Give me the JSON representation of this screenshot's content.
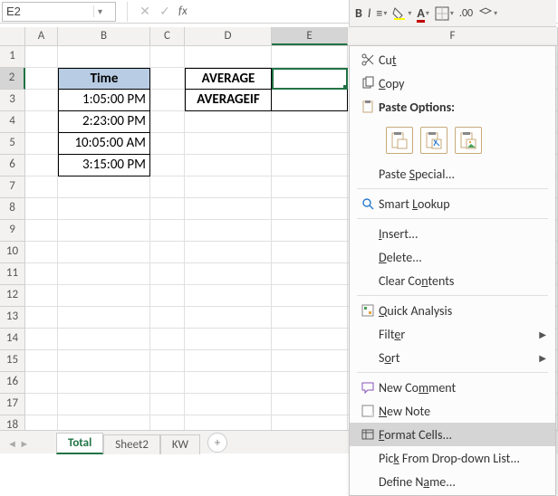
{
  "namebox": {
    "value": "E2"
  },
  "formula_bar": {
    "fx_label": "fx",
    "value": ""
  },
  "mini_ribbon": {
    "bold": "B",
    "italic": "I"
  },
  "columns": [
    "A",
    "B",
    "C",
    "D",
    "E",
    "F"
  ],
  "rows": [
    "1",
    "2",
    "3",
    "4",
    "5",
    "6",
    "7",
    "8",
    "9",
    "10",
    "11",
    "12",
    "13",
    "14",
    "15",
    "16",
    "17",
    "18"
  ],
  "cells": {
    "B2": "Time",
    "B3": "1:05:00 PM",
    "B4": "2:23:00 PM",
    "B5": "10:05:00 AM",
    "B6": "3:15:00 PM",
    "D2": "AVERAGE",
    "D3": "AVERAGEIF"
  },
  "sheet_tabs": {
    "tabs": [
      "Total",
      "Sheet2",
      "KW"
    ],
    "active": "Total",
    "new_label": "+"
  },
  "context_menu": {
    "cut": "Cut",
    "copy": "Copy",
    "paste_options": "Paste Options:",
    "paste_special": "Paste Special...",
    "smart_lookup": "Smart Lookup",
    "insert": "Insert...",
    "delete": "Delete...",
    "clear_contents": "Clear Contents",
    "quick_analysis": "Quick Analysis",
    "filter": "Filter",
    "sort": "Sort",
    "new_comment": "New Comment",
    "new_note": "New Note",
    "format_cells": "Format Cells...",
    "pick_list": "Pick From Drop-down List...",
    "define_name": "Define Name..."
  }
}
